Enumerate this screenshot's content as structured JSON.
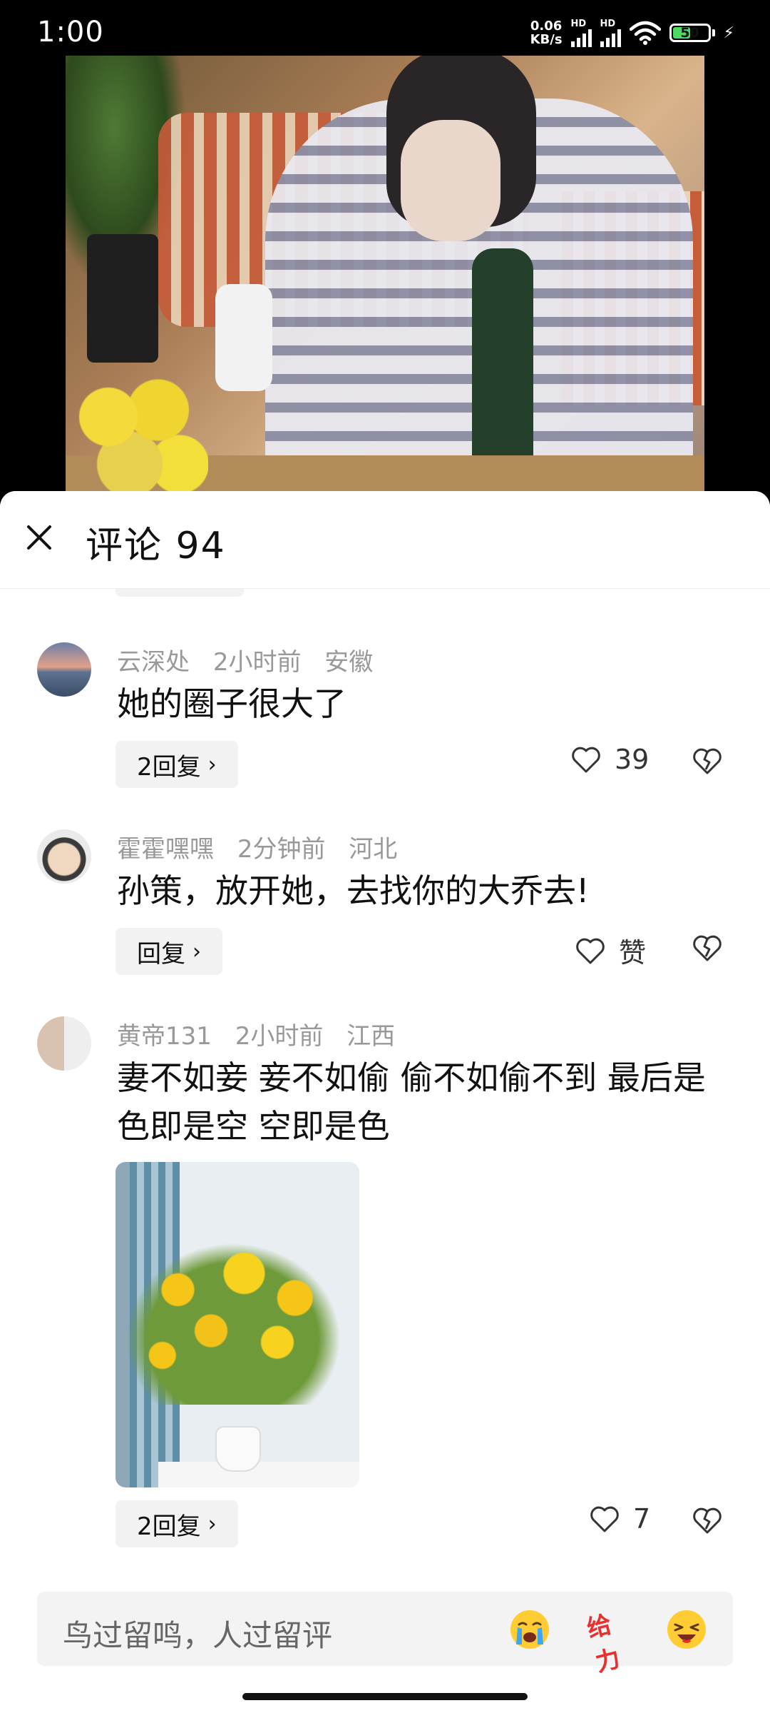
{
  "status_bar": {
    "time": "1:00",
    "speed_value": "0.06",
    "speed_unit": "KB/s",
    "sim1_label": "HD",
    "sim2_label": "HD",
    "battery": "50",
    "battery_level": 0.5
  },
  "video": {
    "icon": "video-frame"
  },
  "sheet": {
    "title": "评论 94",
    "close_icon": "close-icon"
  },
  "comments": [
    {
      "username": "云深处",
      "time": "2小时前",
      "location": "安徽",
      "text": "她的圈子很大了",
      "reply_label": "2回复",
      "like_count": "39"
    },
    {
      "username": "霍霍嘿嘿",
      "time": "2分钟前",
      "location": "河北",
      "text": "孙策，放开她，去找你的大乔去!",
      "reply_label": "回复",
      "like_count": "赞"
    },
    {
      "username": "黄帝131",
      "time": "2小时前",
      "location": "江西",
      "text": "妻不如妾 妾不如偷 偷不如偷不到 最后是色即是空 空即是色",
      "reply_label": "2回复",
      "like_count": "7"
    }
  ],
  "input": {
    "placeholder": "鸟过留鸣，人过留评",
    "emoji_1": "crying-emoji",
    "sticker_text": "给力",
    "emoji_3": "laughing-emoji"
  },
  "colors": {
    "accent_red": "#e8302f",
    "battery_green": "#4cd964",
    "meta_gray": "#999999"
  }
}
